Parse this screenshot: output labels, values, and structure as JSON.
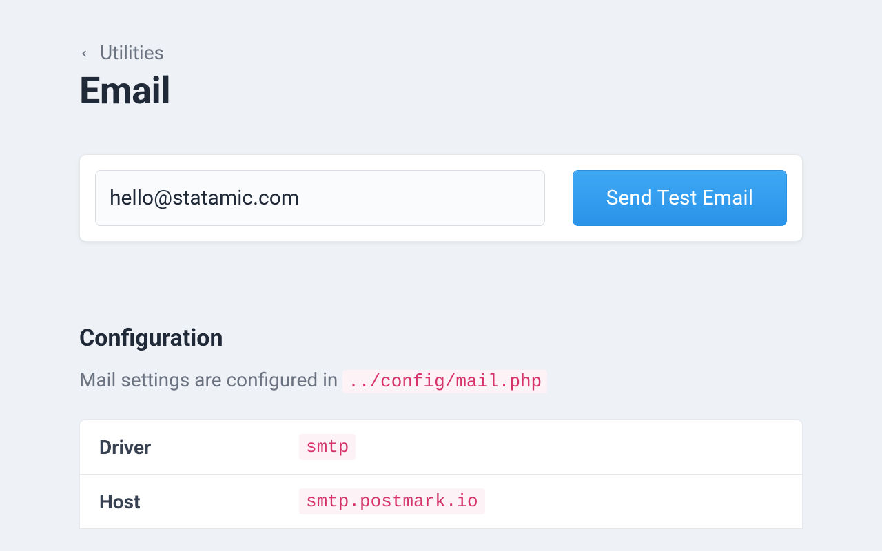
{
  "breadcrumb": {
    "label": "Utilities"
  },
  "page": {
    "title": "Email"
  },
  "form": {
    "email_value": "hello@statamic.com",
    "send_button_label": "Send Test Email"
  },
  "configuration": {
    "title": "Configuration",
    "subtitle_prefix": "Mail settings are configured in ",
    "subtitle_code": "../config/mail.php",
    "rows": [
      {
        "key": "Driver",
        "value": "smtp"
      },
      {
        "key": "Host",
        "value": "smtp.postmark.io"
      }
    ]
  }
}
